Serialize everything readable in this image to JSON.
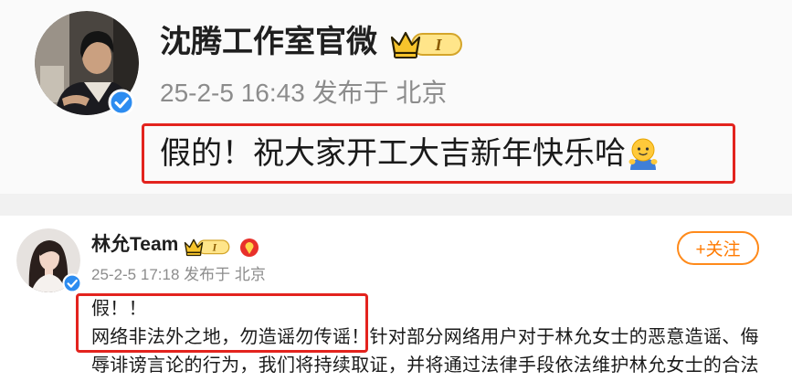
{
  "posts": [
    {
      "author": "沈腾工作室官微",
      "vip_level": "I",
      "meta": "25-2-5 16:43 发布于 北京",
      "text": "假的！祝大家开工大吉新年快乐哈"
    },
    {
      "author": "林允Team",
      "vip_level": "I",
      "meta": "25-2-5 17:18 发布于 北京",
      "follow_label": "+关注",
      "lines": [
        "假！！",
        "网络非法外之地，勿造谣勿传谣！针对部分网络用户对于林允女士的恶意造谣、侮",
        "辱诽谤言论的行为，我们将持续取证，并将通过法律手段依法维护林允女士的合法"
      ]
    }
  ],
  "icons": {
    "verified": "verified-badge-icon",
    "vip": "crown-badge-icon",
    "award": "award-icon",
    "emoji": "hug-emoji-icon"
  },
  "colors": {
    "highlight_border": "#e3231e",
    "follow": "#ff7a00",
    "verified": "#2d8cf0",
    "meta_text": "#8c8c8c"
  }
}
